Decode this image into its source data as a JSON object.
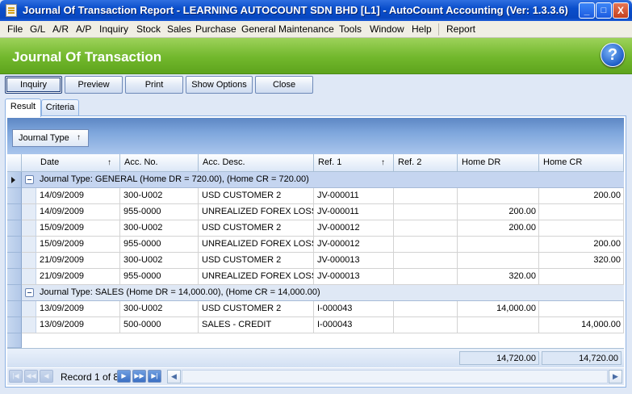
{
  "window": {
    "title": "Journal Of Transaction Report - LEARNING AUTOCOUNT SDN BHD [L1] - AutoCount Accounting (Ver: 1.3.3.6)",
    "min": "_",
    "max": "□",
    "close": "X"
  },
  "menu": [
    "File",
    "G/L",
    "A/R",
    "A/P",
    "Inquiry",
    "Stock",
    "Sales",
    "Purchase",
    "General Maintenance",
    "Tools",
    "Window",
    "Help",
    "Report"
  ],
  "page": {
    "title": "Journal Of Transaction",
    "help": "?"
  },
  "toolbar": {
    "inquiry": "Inquiry",
    "preview": "Preview",
    "print": "Print",
    "show_options": "Show Options",
    "close": "Close"
  },
  "tabs": {
    "result": "Result",
    "criteria": "Criteria"
  },
  "group_panel": {
    "chip": "Journal Type",
    "sort_icon": "↑"
  },
  "columns": [
    "Date",
    "Acc. No.",
    "Acc. Desc.",
    "Ref. 1",
    "Ref. 2",
    "Home DR",
    "Home CR"
  ],
  "sort_icon": "↑",
  "groups": [
    {
      "label": "Journal Type: GENERAL (Home DR = 720.00), (Home CR = 720.00)",
      "rows": [
        [
          "14/09/2009",
          "300-U002",
          "USD CUSTOMER 2",
          "JV-000011",
          "",
          "",
          "200.00"
        ],
        [
          "14/09/2009",
          "955-0000",
          "UNREALIZED  FOREX LOSS",
          "JV-000011",
          "",
          "200.00",
          ""
        ],
        [
          "15/09/2009",
          "300-U002",
          "USD CUSTOMER 2",
          "JV-000012",
          "",
          "200.00",
          ""
        ],
        [
          "15/09/2009",
          "955-0000",
          "UNREALIZED  FOREX LOSS",
          "JV-000012",
          "",
          "",
          "200.00"
        ],
        [
          "21/09/2009",
          "300-U002",
          "USD CUSTOMER 2",
          "JV-000013",
          "",
          "",
          "320.00"
        ],
        [
          "21/09/2009",
          "955-0000",
          "UNREALIZED  FOREX LOSS",
          "JV-000013",
          "",
          "320.00",
          ""
        ]
      ]
    },
    {
      "label": "Journal Type: SALES (Home DR = 14,000.00), (Home CR = 14,000.00)",
      "rows": [
        [
          "13/09/2009",
          "300-U002",
          "USD CUSTOMER 2",
          "I-000043",
          "",
          "14,000.00",
          ""
        ],
        [
          "13/09/2009",
          "500-0000",
          "SALES - CREDIT",
          "I-000043",
          "",
          "",
          "14,000.00"
        ]
      ]
    }
  ],
  "totals": {
    "home_dr": "14,720.00",
    "home_cr": "14,720.00"
  },
  "navigator": {
    "record_text": "Record 1 of 8"
  }
}
